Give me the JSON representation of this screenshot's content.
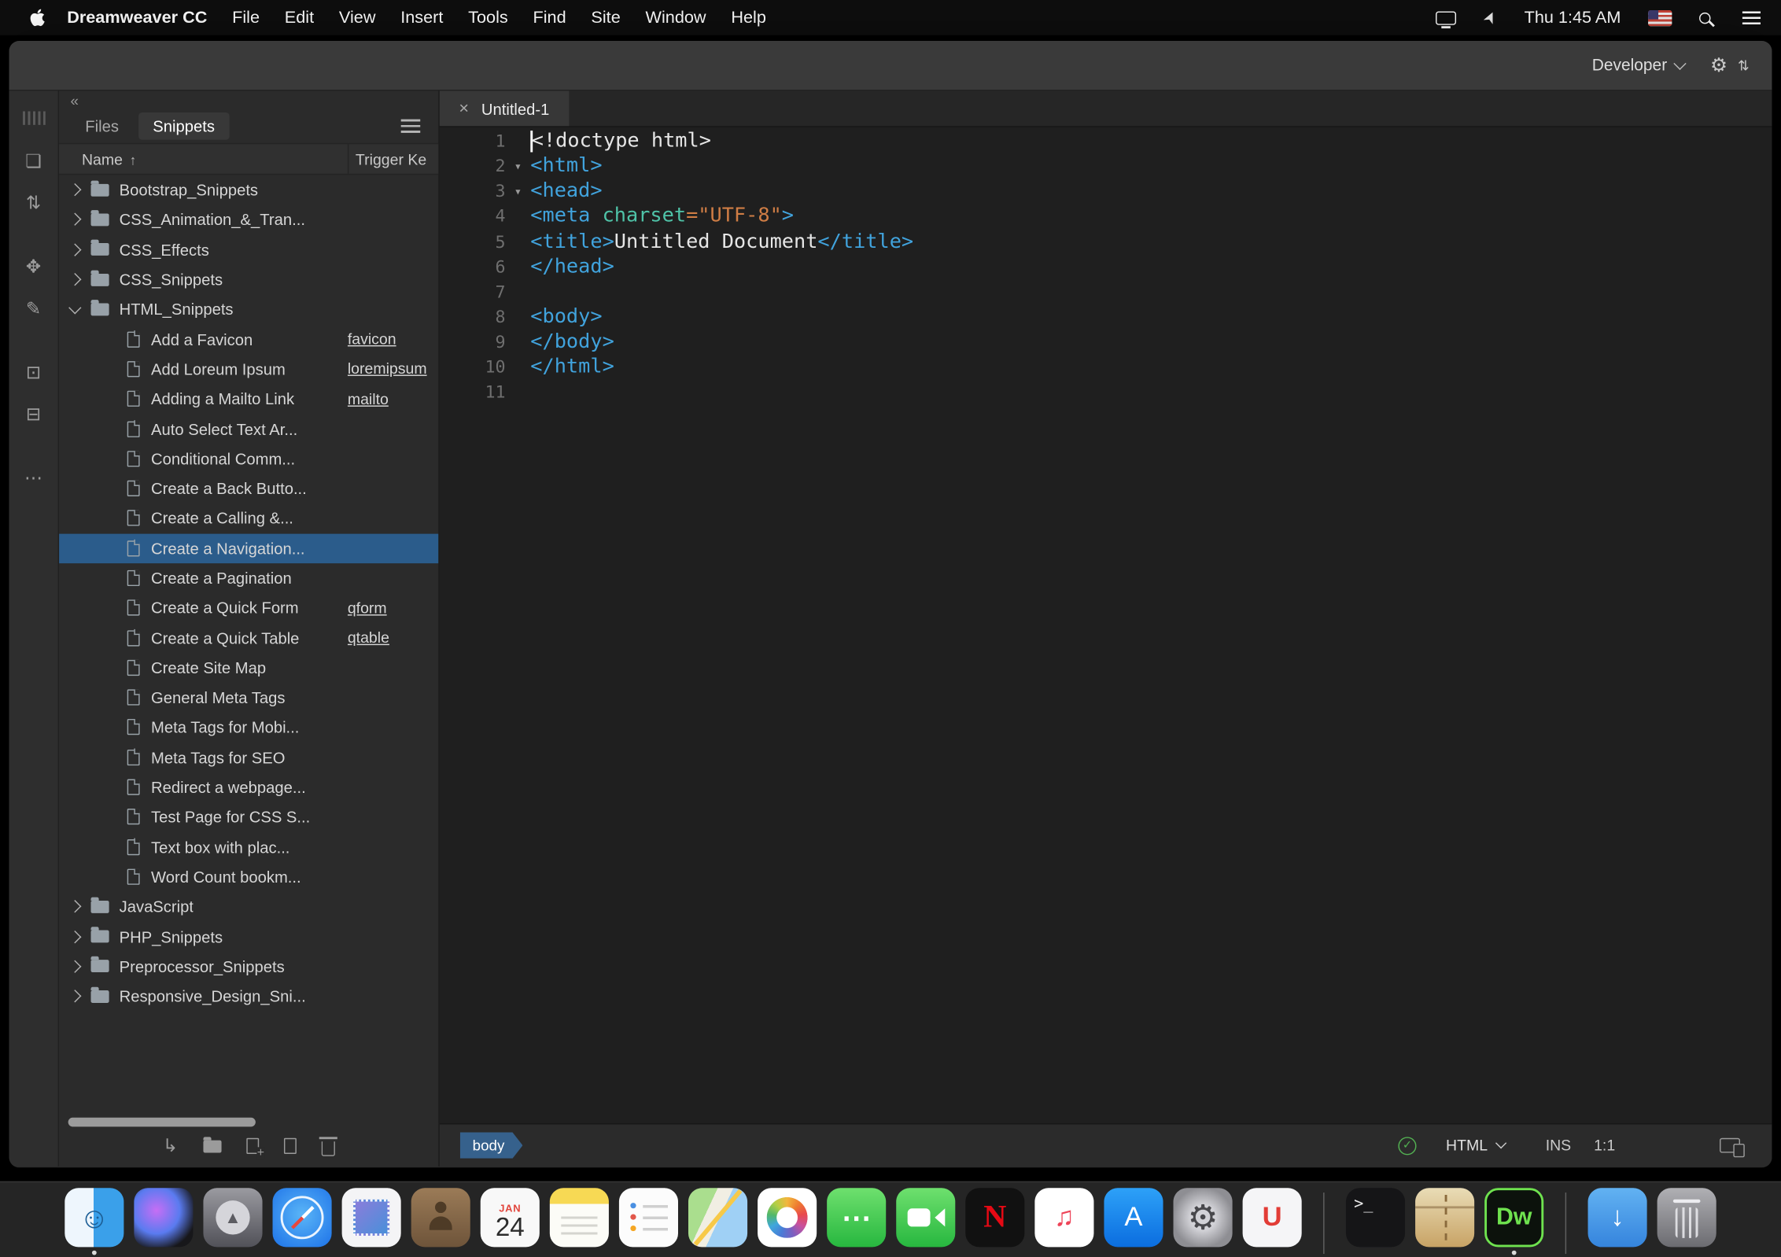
{
  "colors": {
    "selection_blue": "#2b5c8b",
    "tag_blue": "#41a3dd",
    "attr_teal": "#4fc3a8",
    "string_orange": "#cf7d45",
    "dw_green": "#6fe24f",
    "check_green": "#53b152",
    "traffic_red": "#ff5e57",
    "traffic_yellow": "#ffbd2e",
    "traffic_green": "#28c840"
  },
  "menubar": {
    "app_name": "Dreamweaver CC",
    "menus": [
      "File",
      "Edit",
      "View",
      "Insert",
      "Tools",
      "Find",
      "Site",
      "Window",
      "Help"
    ],
    "clock": "Thu 1:45 AM"
  },
  "titlebar": {
    "workspace": "Developer"
  },
  "toolstrip": [
    {
      "name": "pages-icon",
      "glyph": "❏"
    },
    {
      "name": "sort-icon",
      "glyph": "⇅"
    },
    {
      "name": "transform-icon",
      "glyph": "✥",
      "gap": true
    },
    {
      "name": "edit-icon",
      "glyph": "✎"
    },
    {
      "name": "comment-icon",
      "glyph": "⊡",
      "gap": true
    },
    {
      "name": "report-icon",
      "glyph": "⊟"
    },
    {
      "name": "more-icon",
      "glyph": "⋯",
      "gap": true
    }
  ],
  "panel": {
    "collapse_glyph": "«",
    "tabs": [
      {
        "label": "Files",
        "active": false
      },
      {
        "label": "Snippets",
        "active": true
      }
    ],
    "columns": {
      "name": "Name",
      "sort_glyph": "↑",
      "trigger": "Trigger Ke"
    },
    "rows": [
      {
        "kind": "folder",
        "label": "Bootstrap_Snippets"
      },
      {
        "kind": "folder",
        "label": "CSS_Animation_&_Tran..."
      },
      {
        "kind": "folder",
        "label": "CSS_Effects"
      },
      {
        "kind": "folder",
        "label": "CSS_Snippets"
      },
      {
        "kind": "folder",
        "label": "HTML_Snippets",
        "expanded": true
      },
      {
        "kind": "file",
        "label": "Add a Favicon",
        "trigger": "favicon"
      },
      {
        "kind": "file",
        "label": "Add Loreum Ipsum",
        "trigger": "loremipsum"
      },
      {
        "kind": "file",
        "label": "Adding a Mailto Link",
        "trigger": "mailto"
      },
      {
        "kind": "file",
        "label": "Auto Select Text Ar..."
      },
      {
        "kind": "file",
        "label": "Conditional Comm..."
      },
      {
        "kind": "file",
        "label": "Create a Back Butto..."
      },
      {
        "kind": "file",
        "label": "Create a Calling &..."
      },
      {
        "kind": "file",
        "label": "Create a Navigation...",
        "selected": true
      },
      {
        "kind": "file",
        "label": "Create a Pagination"
      },
      {
        "kind": "file",
        "label": "Create a Quick Form",
        "trigger": "qform"
      },
      {
        "kind": "file",
        "label": "Create a Quick Table",
        "trigger": "qtable"
      },
      {
        "kind": "file",
        "label": "Create Site Map"
      },
      {
        "kind": "file",
        "label": "General Meta Tags"
      },
      {
        "kind": "file",
        "label": "Meta Tags for Mobi..."
      },
      {
        "kind": "file",
        "label": "Meta Tags for SEO"
      },
      {
        "kind": "file",
        "label": "Redirect a webpage..."
      },
      {
        "kind": "file",
        "label": "Test Page for CSS S..."
      },
      {
        "kind": "file",
        "label": "Text box with plac..."
      },
      {
        "kind": "file",
        "label": "Word Count bookm..."
      },
      {
        "kind": "folder",
        "label": "JavaScript"
      },
      {
        "kind": "folder",
        "label": "PHP_Snippets"
      },
      {
        "kind": "folder",
        "label": "Preprocessor_Snippets"
      },
      {
        "kind": "folder",
        "label": "Responsive_Design_Sni..."
      }
    ],
    "toolbar": [
      {
        "name": "insert-snippet-icon",
        "glyph": "↳"
      },
      {
        "name": "new-folder-icon",
        "shape": "folder"
      },
      {
        "name": "new-snippet-icon",
        "shape": "page-plus"
      },
      {
        "name": "edit-snippet-icon",
        "shape": "page"
      },
      {
        "name": "delete-snippet-icon",
        "shape": "trash"
      }
    ]
  },
  "editor": {
    "tab_label": "Untitled-1",
    "tab_close_glyph": "×",
    "fold_glyph": "▾",
    "lines": [
      {
        "n": "1",
        "caret": true,
        "tokens": [
          [
            "plain",
            "<!doctype html>"
          ]
        ]
      },
      {
        "n": "2",
        "fold": true,
        "tokens": [
          [
            "tag",
            "<html>"
          ]
        ]
      },
      {
        "n": "3",
        "fold": true,
        "tokens": [
          [
            "tag",
            "<head>"
          ]
        ]
      },
      {
        "n": "4",
        "tokens": [
          [
            "tag",
            "<meta "
          ],
          [
            "attr",
            "charset"
          ],
          [
            "str",
            "=\"UTF-8\""
          ],
          [
            "tag",
            ">"
          ]
        ]
      },
      {
        "n": "5",
        "tokens": [
          [
            "tag",
            "<title>"
          ],
          [
            "plain",
            "Untitled Document"
          ],
          [
            "tag",
            "</title>"
          ]
        ]
      },
      {
        "n": "6",
        "tokens": [
          [
            "tag",
            "</head>"
          ]
        ]
      },
      {
        "n": "7",
        "tokens": []
      },
      {
        "n": "8",
        "tokens": [
          [
            "tag",
            "<body>"
          ]
        ]
      },
      {
        "n": "9",
        "tokens": [
          [
            "tag",
            "</body>"
          ]
        ]
      },
      {
        "n": "10",
        "tokens": [
          [
            "tag",
            "</html>"
          ]
        ]
      },
      {
        "n": "11",
        "tokens": []
      }
    ]
  },
  "statusbar": {
    "tag": "body",
    "check_glyph": "✓",
    "doc_type": "HTML",
    "mode": "INS",
    "position": "1:1"
  },
  "dock": {
    "items": [
      {
        "name": "finder",
        "style": "finder",
        "glyph": "☺",
        "dot": true
      },
      {
        "name": "siri",
        "style": "siri",
        "glyph": ""
      },
      {
        "name": "launchpad",
        "style": "launchpad",
        "glyph": "▲"
      },
      {
        "name": "safari",
        "style": "safari",
        "glyph": ""
      },
      {
        "name": "preview",
        "style": "preview",
        "glyph": ""
      },
      {
        "name": "contacts",
        "style": "contacts",
        "glyph": ""
      },
      {
        "name": "calendar",
        "style": "calendar",
        "month": "JAN",
        "day": "24"
      },
      {
        "name": "notes",
        "style": "notes",
        "glyph": ""
      },
      {
        "name": "reminders",
        "style": "reminders",
        "glyph": ""
      },
      {
        "name": "maps",
        "style": "maps",
        "glyph": ""
      },
      {
        "name": "photos",
        "style": "photos",
        "glyph": ""
      },
      {
        "name": "messages",
        "style": "messages",
        "glyph": "⋯"
      },
      {
        "name": "facetime",
        "style": "facetime",
        "glyph": ""
      },
      {
        "name": "netflix",
        "style": "netflix",
        "glyph": "N"
      },
      {
        "name": "music",
        "style": "music",
        "glyph": "♫"
      },
      {
        "name": "app-store",
        "style": "appstore",
        "glyph": "A"
      },
      {
        "name": "system-preferences",
        "style": "settings",
        "glyph": "⚙"
      },
      {
        "name": "magnet",
        "style": "magnet",
        "glyph": "U"
      },
      {
        "divider": true
      },
      {
        "name": "terminal",
        "style": "terminal",
        "glyph": ">_"
      },
      {
        "name": "archive-utility",
        "style": "archive",
        "glyph": ""
      },
      {
        "name": "dreamweaver",
        "style": "dreamweaver",
        "glyph": "Dw",
        "dot": true
      },
      {
        "divider": true
      },
      {
        "name": "downloads",
        "style": "downloads",
        "glyph": "↓"
      },
      {
        "name": "trash",
        "style": "trash",
        "glyph": ""
      }
    ]
  }
}
